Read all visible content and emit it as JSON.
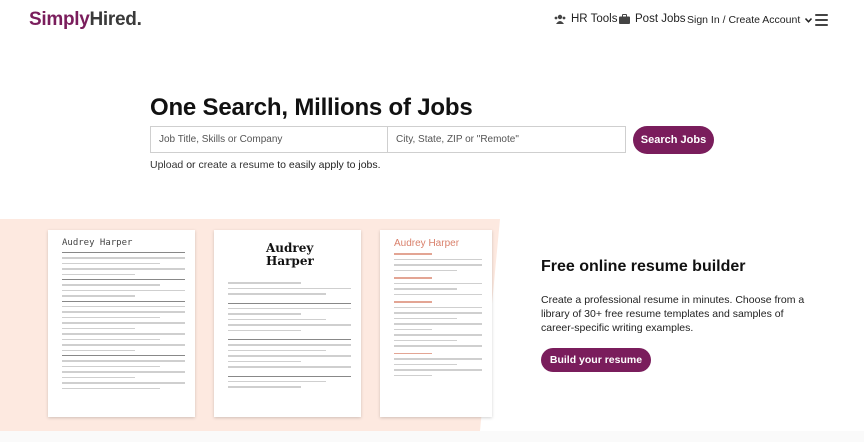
{
  "header": {
    "logo_simply": "Simply",
    "logo_hired": "Hired",
    "logo_dot": ".",
    "hr_tools": "HR Tools",
    "post_jobs": "Post Jobs",
    "sign_in": "Sign In / Create Account"
  },
  "hero": {
    "title": "One Search, Millions of Jobs",
    "job_placeholder": "Job Title, Skills or Company",
    "location_placeholder": "City, State, ZIP or \"Remote\"",
    "search_label": "Search Jobs",
    "upload_text": "Upload",
    "or_text": " or ",
    "create_text": "create a resume",
    "apply_text": " to easily apply to jobs."
  },
  "resumes": [
    {
      "name": "Audrey Harper"
    },
    {
      "name_line1": "Audrey",
      "name_line2": "Harper"
    },
    {
      "name": "Audrey Harper"
    }
  ],
  "builder": {
    "title": "Free online resume builder",
    "description": "Create a professional resume in minutes. Choose from a library of 30+ free resume templates and samples of career-specific writing examples.",
    "button_label": "Build your resume"
  },
  "colors": {
    "brand": "#7a1d5c",
    "band": "#fde9e0"
  }
}
